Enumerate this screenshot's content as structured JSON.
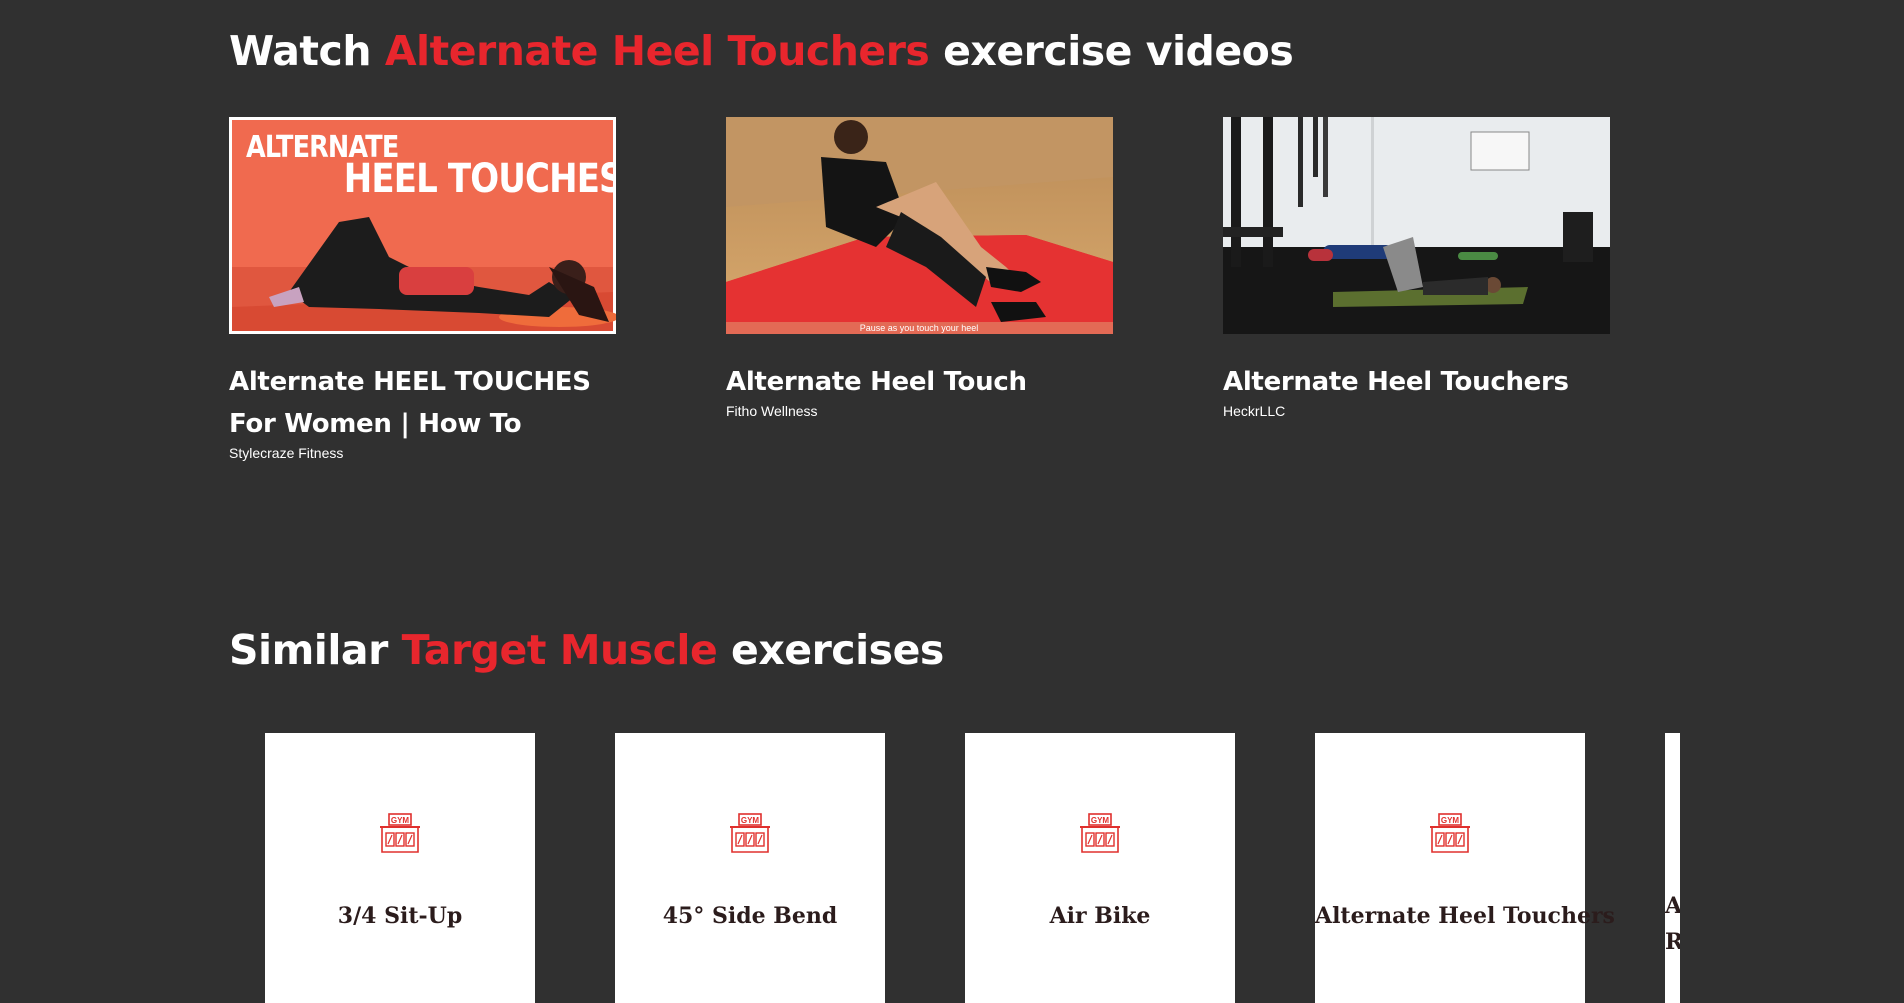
{
  "videos_section": {
    "heading_prefix": "Watch",
    "heading_accent": "Alternate Heel Touchers",
    "heading_suffix": "exercise videos",
    "videos": [
      {
        "title": "Alternate HEEL TOUCHES For Women | How To",
        "channel": "Stylecraze Fitness",
        "thumbnail_text_line1": "ALTERNATE",
        "thumbnail_text_line2": "HEEL TOUCHES"
      },
      {
        "title": "Alternate Heel Touch",
        "channel": "Fitho Wellness",
        "thumbnail_caption": "Pause as you touch your heel"
      },
      {
        "title": "Alternate Heel Touchers",
        "channel": "HeckrLLC"
      }
    ]
  },
  "similar_section": {
    "heading_prefix": "Similar",
    "heading_accent": "Target Muscle",
    "heading_suffix": "exercises",
    "exercises": [
      {
        "name": "3/4 Sit-Up",
        "icon": "gym-icon"
      },
      {
        "name": "45° Side Bend",
        "icon": "gym-icon"
      },
      {
        "name": "Air Bike",
        "icon": "gym-icon"
      },
      {
        "name": "Alternate Heel Touchers",
        "icon": "gym-icon"
      },
      {
        "name_partial": "A R"
      }
    ],
    "icon_label": "GYM"
  },
  "colors": {
    "background": "#303030",
    "accent": "#e8262d",
    "card": "#ffffff",
    "card_text": "#2b1c1c"
  }
}
